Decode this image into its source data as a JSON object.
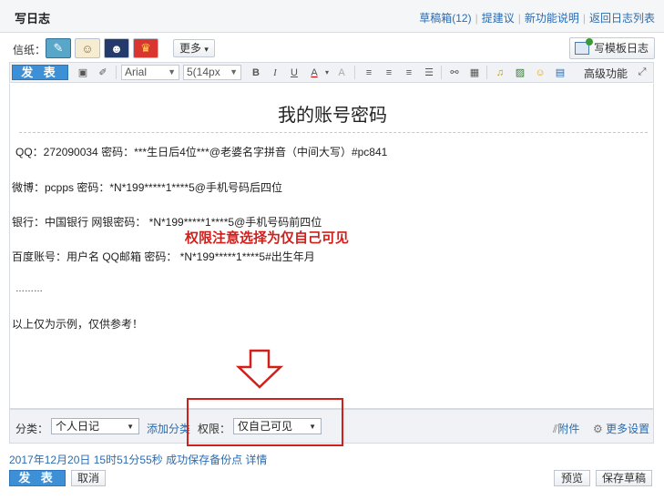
{
  "header": {
    "title": "写日志",
    "links": [
      "草稿箱(12)",
      "提建议",
      "新功能说明",
      "返回日志列表"
    ]
  },
  "paper": {
    "label": "信纸：",
    "more_label": "更多",
    "template_button": "写模板日志"
  },
  "toolbar": {
    "publish_label": "发 表",
    "font_family": "Arial",
    "font_size": "5(14px",
    "advanced_label": "高级功能"
  },
  "document": {
    "title": "我的账号密码",
    "lines": [
      "QQ：272090034 密码：***生日后4位***@老婆名字拼音（中间大写）#pc841",
      "微博：pcpps 密码：*N*199*****1****5@手机号码后四位",
      "银行：中国银行 网银密码： *N*199*****1****5@手机号码前四位",
      "百度账号：用户名 QQ邮箱 密码： *N*199*****1****5#出生年月",
      "………",
      "以上仅为示例，仅供参考！"
    ],
    "annotation": "权限注意选择为仅自己可见"
  },
  "bottom": {
    "category_label": "分类：",
    "category_value": "个人日记",
    "add_category": "添加分类",
    "permission_label": "权限：",
    "permission_value": "仅自己可见",
    "attachment": "附件",
    "more_settings": "更多设置"
  },
  "status": {
    "text": "2017年12月20日 15时51分55秒 成功保存备份点 详情"
  },
  "actions": {
    "publish": "发 表",
    "cancel": "取消",
    "preview": "预览",
    "save_draft": "保存草稿"
  },
  "colors": {
    "accent": "#3d8fd6",
    "link": "#2b6cb0",
    "annotation_red": "#d0201c"
  }
}
